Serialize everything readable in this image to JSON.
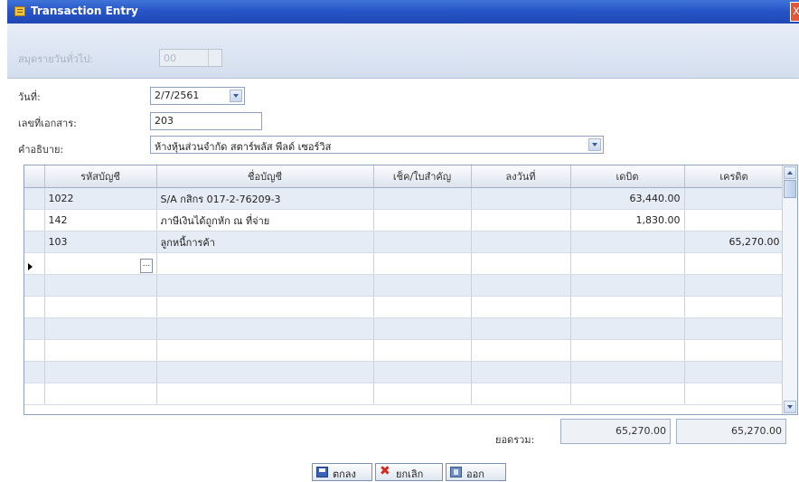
{
  "window": {
    "title": "Transaction Entry",
    "close": "X"
  },
  "filter": {
    "label": "สมุดรายวันทั่วไป:",
    "value": "00"
  },
  "form": {
    "date_label": "วันที่:",
    "date_value": "2/7/2561",
    "doc_label": "เลขที่เอกสาร:",
    "doc_value": "203",
    "desc_label": "คำอธิบาย:",
    "desc_value": "ห้างหุ้นส่วนจำกัด สตาร์พลัส พีลด์ เซอร์วิส"
  },
  "grid": {
    "columns": [
      "รหัสบัญชี",
      "ชื่อบัญชี",
      "เช็ค/ใบสำคัญ",
      "ลงวันที่",
      "เดบิต",
      "เครดิต"
    ],
    "rows": [
      {
        "code": "1022",
        "name": "S/A กสิกร 017-2-76209-3",
        "ref": "",
        "date": "",
        "debit": "63,440.00",
        "credit": ""
      },
      {
        "code": "142",
        "name": "ภาษีเงินได้ถูกหัก ณ ที่จ่าย",
        "ref": "",
        "date": "",
        "debit": "1,830.00",
        "credit": ""
      },
      {
        "code": "103",
        "name": "ลูกหนี้การค้า",
        "ref": "",
        "date": "",
        "debit": "",
        "credit": "65,270.00"
      }
    ],
    "ellipsis": "..."
  },
  "totals": {
    "label": "ยอดรวม:",
    "debit": "65,270.00",
    "credit": "65,270.00"
  },
  "buttons": {
    "ok": "ตกลง",
    "cancel": "ยกเลิก",
    "exit": "ออก"
  }
}
